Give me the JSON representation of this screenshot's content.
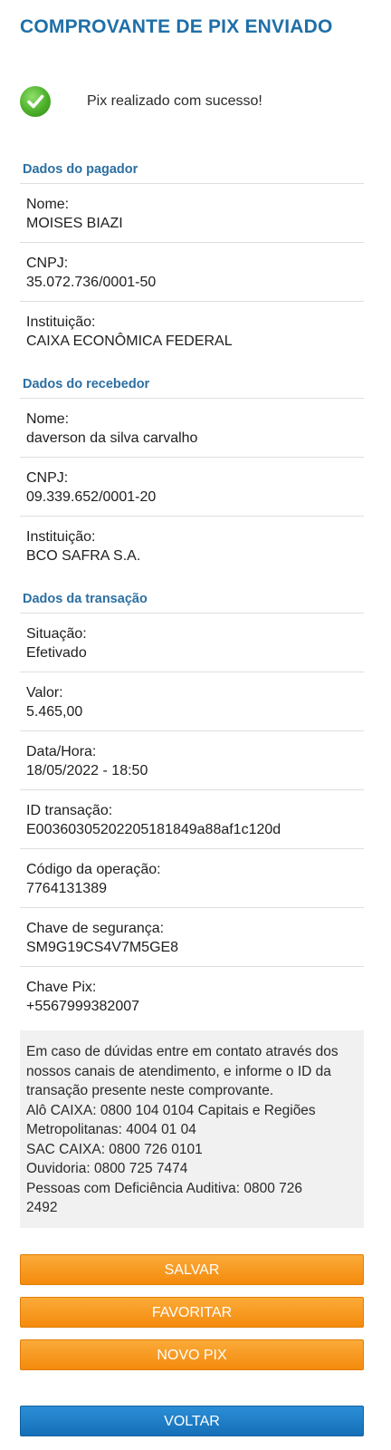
{
  "page": {
    "title": "COMPROVANTE DE PIX ENVIADO",
    "success_message": "Pix realizado com sucesso!"
  },
  "payer": {
    "section_title": "Dados do pagador",
    "fields": [
      {
        "label": "Nome:",
        "value": "MOISES BIAZI"
      },
      {
        "label": "CNPJ:",
        "value": "35.072.736/0001-50"
      },
      {
        "label": "Instituição:",
        "value": "CAIXA ECONÔMICA FEDERAL"
      }
    ]
  },
  "receiver": {
    "section_title": "Dados do recebedor",
    "fields": [
      {
        "label": "Nome:",
        "value": "daverson da silva carvalho"
      },
      {
        "label": "CNPJ:",
        "value": "09.339.652/0001-20"
      },
      {
        "label": "Instituição:",
        "value": "BCO SAFRA S.A."
      }
    ]
  },
  "transaction": {
    "section_title": "Dados da transação",
    "fields": [
      {
        "label": "Situação:",
        "value": "Efetivado"
      },
      {
        "label": "Valor:",
        "value": "5.465,00"
      },
      {
        "label": "Data/Hora:",
        "value": "18/05/2022 - 18:50"
      },
      {
        "label": "ID transação:",
        "value": "E00360305202205181849a88af1c120d"
      },
      {
        "label": "Código da operação:",
        "value": "7764131389"
      },
      {
        "label": "Chave de segurança:",
        "value": "SM9G19CS4V7M5GE8"
      },
      {
        "label": "Chave Pix:",
        "value": "+5567999382007"
      }
    ]
  },
  "info": {
    "lines": [
      "Em caso de dúvidas entre em contato através dos",
      "nossos canais de atendimento, e informe o ID da",
      "transação presente neste comprovante.",
      "Alô CAIXA: 0800 104 0104 Capitais e Regiões",
      "Metropolitanas: 4004 01 04",
      "SAC CAIXA: 0800 726 0101",
      "Ouvidoria: 0800 725 7474",
      "Pessoas com Deficiência Auditiva: 0800 726",
      "2492"
    ]
  },
  "buttons": {
    "save": "SALVAR",
    "favorite": "FAVORITAR",
    "new_pix": "NOVO PIX",
    "back": "VOLTAR"
  },
  "colors": {
    "title": "#1f6fa8",
    "section_title": "#2c6fa2",
    "orange_button": "#f7960f",
    "blue_button": "#1c7cc7",
    "success_icon": "#4caf2a"
  },
  "icons": {
    "success": "check-circle-icon"
  }
}
